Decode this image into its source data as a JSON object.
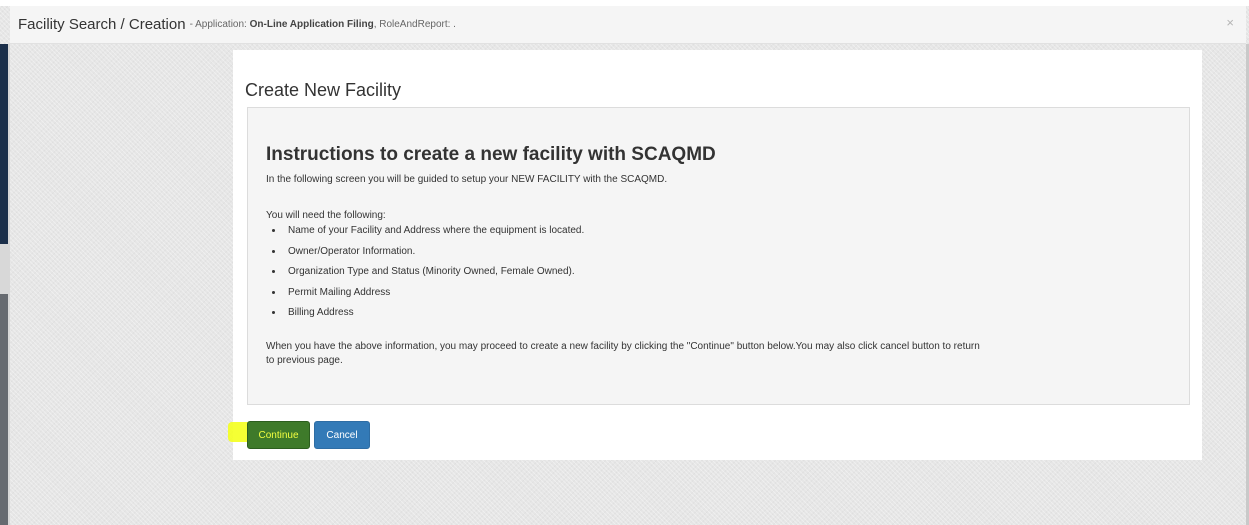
{
  "header": {
    "title": "Facility Search / Creation",
    "subtitle_prefix": "- Application:",
    "application_name": "On-Line Application Filing",
    "subtitle_suffix": ", RoleAndReport: .",
    "close_glyph": "×"
  },
  "panel": {
    "heading": "Create New Facility"
  },
  "instructions": {
    "title": "Instructions to create a new facility with SCAQMD",
    "intro": "In the following screen you will be guided to setup your NEW FACILITY with the SCAQMD.",
    "needs_label": "You will need the following:",
    "requirements": [
      "Name of your Facility and Address where the equipment is located.",
      "Owner/Operator Information.",
      "Organization Type and Status (Minority Owned, Female Owned).",
      "Permit Mailing Address",
      "Billing Address"
    ],
    "closing": "When you have the above information, you may proceed to create a new facility by clicking the \"Continue\" button below.You may also click cancel button to return to previous page."
  },
  "actions": {
    "continue_label": "Continue",
    "cancel_label": "Cancel"
  },
  "colors": {
    "primary_button": "#337ab7",
    "highlight": "#f4ff1e"
  }
}
